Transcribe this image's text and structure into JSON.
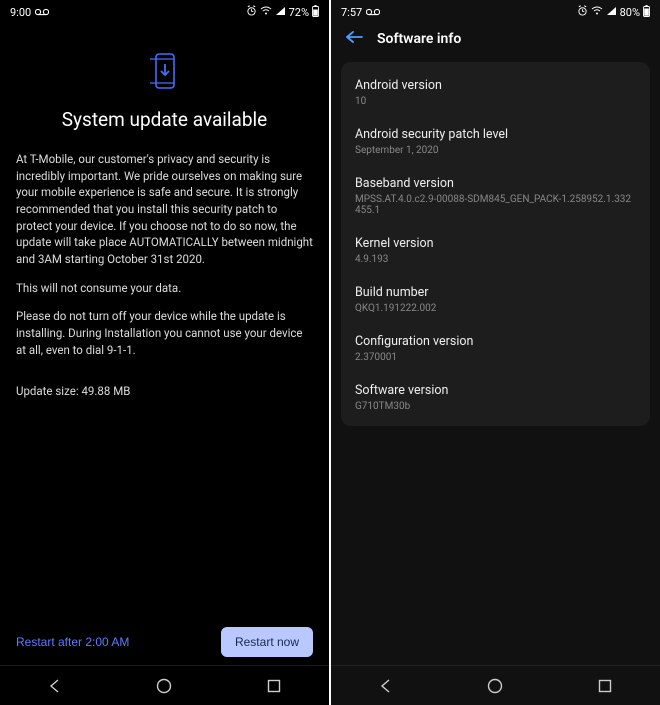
{
  "left": {
    "statusbar": {
      "time": "9:00",
      "battery": "72%"
    },
    "title": "System update available",
    "para1": "At T-Mobile, our customer's privacy and security is incredibly important. We pride ourselves on making sure your mobile experience is safe and secure. It is strongly recommended that you install this security patch to protect your device. If you choose not to do so now, the update will take place AUTOMATICALLY between midnight and 3AM starting October 31st 2020.",
    "para2": "This will not consume your data.",
    "para3": "Please do not turn off your device while the update is installing. During Installation you cannot use your device at all, even to dial 9-1-1.",
    "size": "Update size: 49.88 MB",
    "restart_later": "Restart after 2:00 AM",
    "restart_now": "Restart now"
  },
  "right": {
    "statusbar": {
      "time": "7:57",
      "battery": "80%"
    },
    "header": "Software info",
    "items": [
      {
        "label": "Android version",
        "value": "10"
      },
      {
        "label": "Android security patch level",
        "value": "September 1, 2020"
      },
      {
        "label": "Baseband version",
        "value": "MPSS.AT.4.0.c2.9-00088-SDM845_GEN_PACK-1.258952.1.332455.1"
      },
      {
        "label": "Kernel version",
        "value": "4.9.193"
      },
      {
        "label": "Build number",
        "value": "QKQ1.191222.002"
      },
      {
        "label": "Configuration version",
        "value": "2.370001"
      },
      {
        "label": "Software version",
        "value": "G710TM30b"
      }
    ]
  }
}
